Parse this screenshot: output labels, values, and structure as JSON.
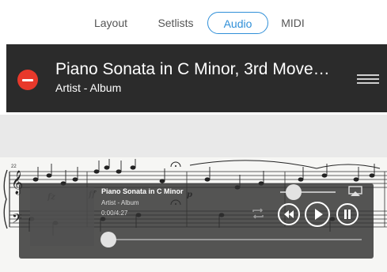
{
  "tabs": [
    {
      "label": "Layout"
    },
    {
      "label": "Setlists"
    },
    {
      "label": "Audio",
      "active": true
    },
    {
      "label": "MIDI"
    }
  ],
  "song": {
    "title": "Piano Sonata in C Minor, 3rd Move…",
    "subtitle": "Artist - Album"
  },
  "score": {
    "measure_number": "22",
    "dynamics": [
      "fz",
      "ff",
      "p"
    ]
  },
  "player": {
    "title": "Piano Sonata in C Minor",
    "subtitle": "Artist - Album",
    "time": "0:00/4:27",
    "progress_fraction": 0.0,
    "volume_fraction": 0.1
  },
  "icons": {
    "remove": "minus-circle-icon",
    "reorder": "hamburger-icon",
    "airplay": "airplay-icon",
    "repeat": "repeat-icon",
    "previous": "previous-icon",
    "play": "play-icon",
    "pause": "pause-icon"
  },
  "colors": {
    "accent": "#2f8fd8",
    "remove": "#e8392b",
    "row_bg": "#2b2b2b"
  }
}
